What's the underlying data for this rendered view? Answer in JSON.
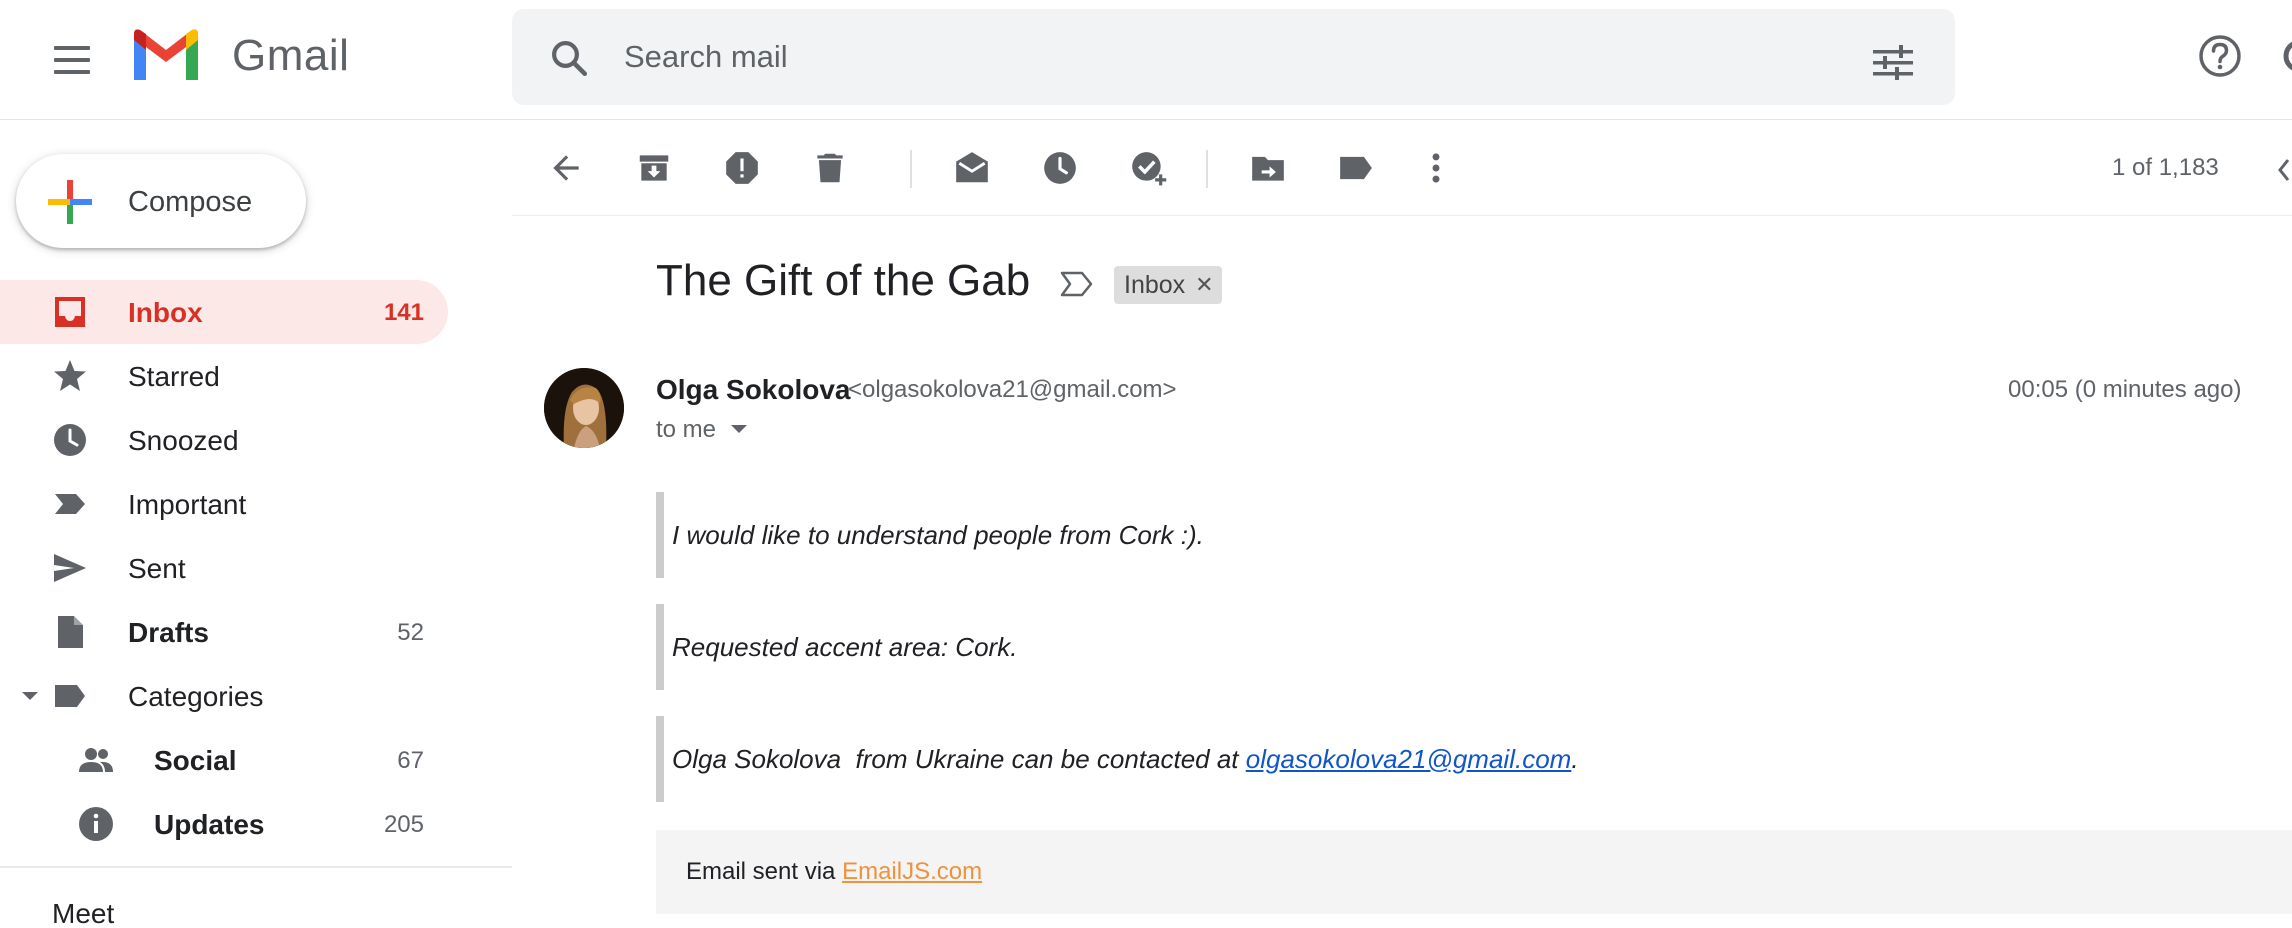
{
  "app": {
    "name": "Gmail"
  },
  "search": {
    "placeholder": "Search mail"
  },
  "compose": {
    "label": "Compose"
  },
  "sidebar": {
    "items": [
      {
        "label": "Inbox",
        "count": "141",
        "icon": "inbox-icon"
      },
      {
        "label": "Starred",
        "count": "",
        "icon": "star-icon"
      },
      {
        "label": "Snoozed",
        "count": "",
        "icon": "clock-icon"
      },
      {
        "label": "Important",
        "count": "",
        "icon": "important-icon"
      },
      {
        "label": "Sent",
        "count": "",
        "icon": "send-icon"
      },
      {
        "label": "Drafts",
        "count": "52",
        "icon": "draft-icon"
      },
      {
        "label": "Categories",
        "count": "",
        "icon": "label-icon"
      },
      {
        "label": "Social",
        "count": "67",
        "icon": "people-icon"
      },
      {
        "label": "Updates",
        "count": "205",
        "icon": "info-icon"
      }
    ],
    "meet_label": "Meet"
  },
  "toolbar": {
    "pager": "1 of 1,183",
    "icons": [
      "back-arrow-icon",
      "archive-icon",
      "report-spam-icon",
      "delete-icon",
      "mark-unread-icon",
      "snooze-icon",
      "add-to-tasks-icon",
      "move-to-icon",
      "labels-icon",
      "more-icon"
    ]
  },
  "message": {
    "subject": "The Gift of the Gab",
    "label": "Inbox",
    "sender_name": "Olga Sokolova",
    "sender_email": "<olgasokolova21@gmail.com>",
    "timestamp": "00:05 (0 minutes ago)",
    "recipient": "to me",
    "body": {
      "line1": "I would like to understand people from Cork :).",
      "line2": "Requested accent area: Cork.",
      "line3_prefix": "Olga Sokolova  from Ukraine can be contacted at ",
      "line3_link": "olgasokolova21@gmail.com",
      "line3_suffix": "."
    },
    "footer": {
      "prefix": "Email sent via ",
      "link": "EmailJS.com"
    }
  },
  "colors": {
    "accent_red": "#d93025",
    "active_bg": "#fce8e6",
    "link_blue": "#1155cc",
    "footer_link": "#f0913b"
  }
}
